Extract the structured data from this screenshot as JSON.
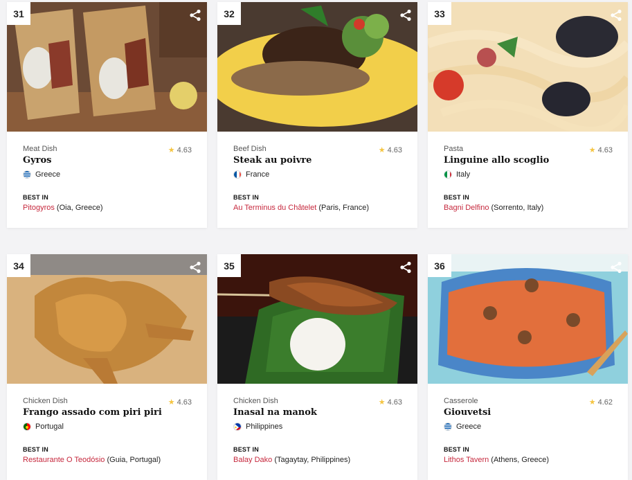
{
  "best_in_label": "BEST IN",
  "cards": [
    {
      "rank": "31",
      "category": "Meat Dish",
      "rating": "4.63",
      "name": "Gyros",
      "country": "Greece",
      "place": "Pitogyros",
      "place_loc": "(Oia, Greece)"
    },
    {
      "rank": "32",
      "category": "Beef Dish",
      "rating": "4.63",
      "name": "Steak au poivre",
      "country": "France",
      "place": "Au Terminus du Châtelet",
      "place_loc": "(Paris, France)"
    },
    {
      "rank": "33",
      "category": "Pasta",
      "rating": "4.63",
      "name": "Linguine allo scoglio",
      "country": "Italy",
      "place": "Bagni Delfino",
      "place_loc": "(Sorrento, Italy)"
    },
    {
      "rank": "34",
      "category": "Chicken Dish",
      "rating": "4.63",
      "name": "Frango assado com piri piri",
      "country": "Portugal",
      "place": "Restaurante O Teodósio",
      "place_loc": "(Guia, Portugal)"
    },
    {
      "rank": "35",
      "category": "Chicken Dish",
      "rating": "4.63",
      "name": "Inasal na manok",
      "country": "Philippines",
      "place": "Balay Dako",
      "place_loc": "(Tagaytay, Philippines)"
    },
    {
      "rank": "36",
      "category": "Casserole",
      "rating": "4.62",
      "name": "Giouvetsi",
      "country": "Greece",
      "place": "Lithos Tavern",
      "place_loc": "(Athens, Greece)"
    }
  ],
  "colors": {
    "accent_link": "#c6283d",
    "star": "#f5c542"
  },
  "icons": {
    "share": "share-icon",
    "star": "star-icon"
  }
}
